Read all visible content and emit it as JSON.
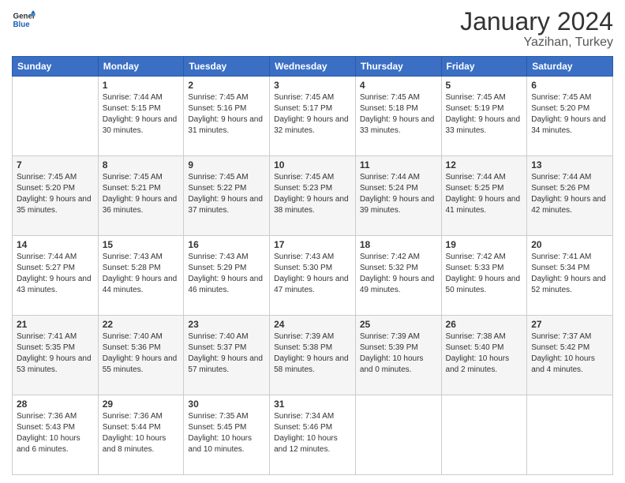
{
  "header": {
    "logo_line1": "General",
    "logo_line2": "Blue",
    "title": "January 2024",
    "subtitle": "Yazihan, Turkey"
  },
  "days_of_week": [
    "Sunday",
    "Monday",
    "Tuesday",
    "Wednesday",
    "Thursday",
    "Friday",
    "Saturday"
  ],
  "weeks": [
    [
      {
        "day": "",
        "sunrise": "",
        "sunset": "",
        "daylight": ""
      },
      {
        "day": "1",
        "sunrise": "Sunrise: 7:44 AM",
        "sunset": "Sunset: 5:15 PM",
        "daylight": "Daylight: 9 hours and 30 minutes."
      },
      {
        "day": "2",
        "sunrise": "Sunrise: 7:45 AM",
        "sunset": "Sunset: 5:16 PM",
        "daylight": "Daylight: 9 hours and 31 minutes."
      },
      {
        "day": "3",
        "sunrise": "Sunrise: 7:45 AM",
        "sunset": "Sunset: 5:17 PM",
        "daylight": "Daylight: 9 hours and 32 minutes."
      },
      {
        "day": "4",
        "sunrise": "Sunrise: 7:45 AM",
        "sunset": "Sunset: 5:18 PM",
        "daylight": "Daylight: 9 hours and 33 minutes."
      },
      {
        "day": "5",
        "sunrise": "Sunrise: 7:45 AM",
        "sunset": "Sunset: 5:19 PM",
        "daylight": "Daylight: 9 hours and 33 minutes."
      },
      {
        "day": "6",
        "sunrise": "Sunrise: 7:45 AM",
        "sunset": "Sunset: 5:20 PM",
        "daylight": "Daylight: 9 hours and 34 minutes."
      }
    ],
    [
      {
        "day": "7",
        "sunrise": "Sunrise: 7:45 AM",
        "sunset": "Sunset: 5:20 PM",
        "daylight": "Daylight: 9 hours and 35 minutes."
      },
      {
        "day": "8",
        "sunrise": "Sunrise: 7:45 AM",
        "sunset": "Sunset: 5:21 PM",
        "daylight": "Daylight: 9 hours and 36 minutes."
      },
      {
        "day": "9",
        "sunrise": "Sunrise: 7:45 AM",
        "sunset": "Sunset: 5:22 PM",
        "daylight": "Daylight: 9 hours and 37 minutes."
      },
      {
        "day": "10",
        "sunrise": "Sunrise: 7:45 AM",
        "sunset": "Sunset: 5:23 PM",
        "daylight": "Daylight: 9 hours and 38 minutes."
      },
      {
        "day": "11",
        "sunrise": "Sunrise: 7:44 AM",
        "sunset": "Sunset: 5:24 PM",
        "daylight": "Daylight: 9 hours and 39 minutes."
      },
      {
        "day": "12",
        "sunrise": "Sunrise: 7:44 AM",
        "sunset": "Sunset: 5:25 PM",
        "daylight": "Daylight: 9 hours and 41 minutes."
      },
      {
        "day": "13",
        "sunrise": "Sunrise: 7:44 AM",
        "sunset": "Sunset: 5:26 PM",
        "daylight": "Daylight: 9 hours and 42 minutes."
      }
    ],
    [
      {
        "day": "14",
        "sunrise": "Sunrise: 7:44 AM",
        "sunset": "Sunset: 5:27 PM",
        "daylight": "Daylight: 9 hours and 43 minutes."
      },
      {
        "day": "15",
        "sunrise": "Sunrise: 7:43 AM",
        "sunset": "Sunset: 5:28 PM",
        "daylight": "Daylight: 9 hours and 44 minutes."
      },
      {
        "day": "16",
        "sunrise": "Sunrise: 7:43 AM",
        "sunset": "Sunset: 5:29 PM",
        "daylight": "Daylight: 9 hours and 46 minutes."
      },
      {
        "day": "17",
        "sunrise": "Sunrise: 7:43 AM",
        "sunset": "Sunset: 5:30 PM",
        "daylight": "Daylight: 9 hours and 47 minutes."
      },
      {
        "day": "18",
        "sunrise": "Sunrise: 7:42 AM",
        "sunset": "Sunset: 5:32 PM",
        "daylight": "Daylight: 9 hours and 49 minutes."
      },
      {
        "day": "19",
        "sunrise": "Sunrise: 7:42 AM",
        "sunset": "Sunset: 5:33 PM",
        "daylight": "Daylight: 9 hours and 50 minutes."
      },
      {
        "day": "20",
        "sunrise": "Sunrise: 7:41 AM",
        "sunset": "Sunset: 5:34 PM",
        "daylight": "Daylight: 9 hours and 52 minutes."
      }
    ],
    [
      {
        "day": "21",
        "sunrise": "Sunrise: 7:41 AM",
        "sunset": "Sunset: 5:35 PM",
        "daylight": "Daylight: 9 hours and 53 minutes."
      },
      {
        "day": "22",
        "sunrise": "Sunrise: 7:40 AM",
        "sunset": "Sunset: 5:36 PM",
        "daylight": "Daylight: 9 hours and 55 minutes."
      },
      {
        "day": "23",
        "sunrise": "Sunrise: 7:40 AM",
        "sunset": "Sunset: 5:37 PM",
        "daylight": "Daylight: 9 hours and 57 minutes."
      },
      {
        "day": "24",
        "sunrise": "Sunrise: 7:39 AM",
        "sunset": "Sunset: 5:38 PM",
        "daylight": "Daylight: 9 hours and 58 minutes."
      },
      {
        "day": "25",
        "sunrise": "Sunrise: 7:39 AM",
        "sunset": "Sunset: 5:39 PM",
        "daylight": "Daylight: 10 hours and 0 minutes."
      },
      {
        "day": "26",
        "sunrise": "Sunrise: 7:38 AM",
        "sunset": "Sunset: 5:40 PM",
        "daylight": "Daylight: 10 hours and 2 minutes."
      },
      {
        "day": "27",
        "sunrise": "Sunrise: 7:37 AM",
        "sunset": "Sunset: 5:42 PM",
        "daylight": "Daylight: 10 hours and 4 minutes."
      }
    ],
    [
      {
        "day": "28",
        "sunrise": "Sunrise: 7:36 AM",
        "sunset": "Sunset: 5:43 PM",
        "daylight": "Daylight: 10 hours and 6 minutes."
      },
      {
        "day": "29",
        "sunrise": "Sunrise: 7:36 AM",
        "sunset": "Sunset: 5:44 PM",
        "daylight": "Daylight: 10 hours and 8 minutes."
      },
      {
        "day": "30",
        "sunrise": "Sunrise: 7:35 AM",
        "sunset": "Sunset: 5:45 PM",
        "daylight": "Daylight: 10 hours and 10 minutes."
      },
      {
        "day": "31",
        "sunrise": "Sunrise: 7:34 AM",
        "sunset": "Sunset: 5:46 PM",
        "daylight": "Daylight: 10 hours and 12 minutes."
      },
      {
        "day": "",
        "sunrise": "",
        "sunset": "",
        "daylight": ""
      },
      {
        "day": "",
        "sunrise": "",
        "sunset": "",
        "daylight": ""
      },
      {
        "day": "",
        "sunrise": "",
        "sunset": "",
        "daylight": ""
      }
    ]
  ]
}
